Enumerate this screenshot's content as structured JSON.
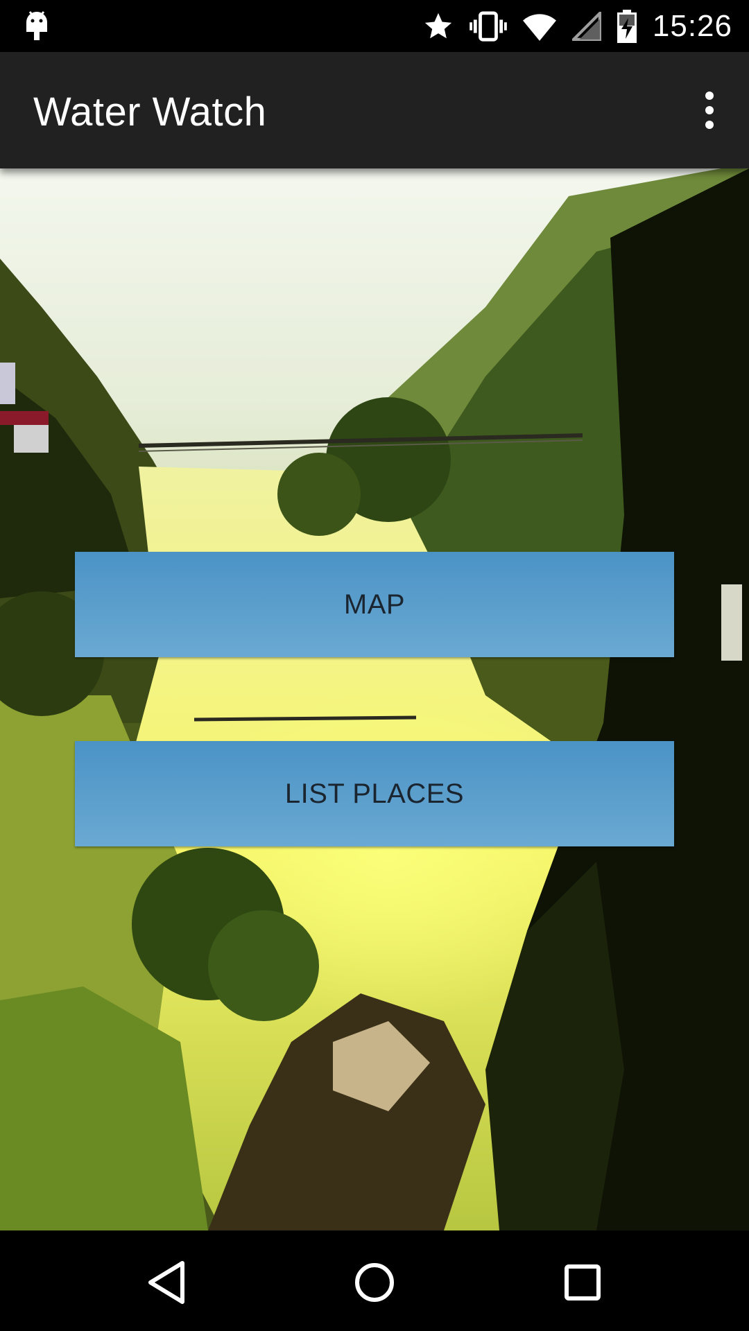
{
  "status_bar": {
    "time": "15:26",
    "icons": [
      "android-debug-icon",
      "star-icon",
      "vibrate-icon",
      "wifi-icon",
      "cell-signal-icon",
      "battery-charging-icon"
    ]
  },
  "app_bar": {
    "title": "Water Watch",
    "menu_icon": "overflow-menu-icon"
  },
  "main": {
    "background": "river-valley-photo",
    "buttons": [
      {
        "label": "MAP"
      },
      {
        "label": "LIST PLACES"
      }
    ]
  },
  "nav_bar": {
    "icons": [
      "back-icon",
      "home-icon",
      "recents-icon"
    ]
  },
  "colors": {
    "status_bar": "#000000",
    "app_bar": "#212121",
    "button_fill": "#5a9ecd",
    "button_text": "#1b2530"
  }
}
